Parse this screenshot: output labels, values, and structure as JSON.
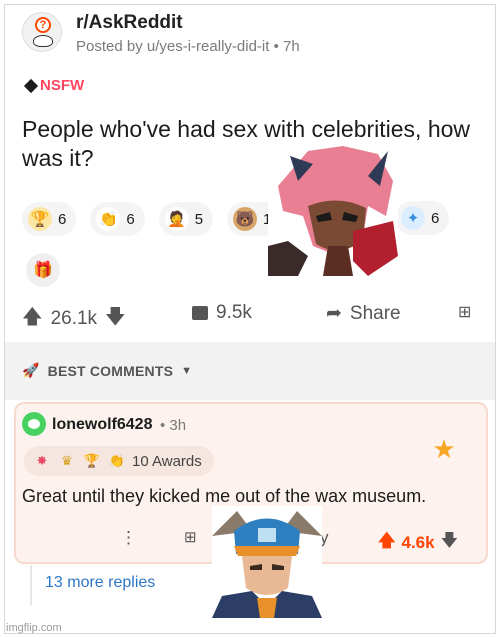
{
  "post": {
    "subreddit": "r/AskReddit",
    "posted_by": "Posted by u/yes-i-really-did-it • 7h",
    "nsfw_tag": "NSFW",
    "title": "People who've had sex with celebrities, how was it?",
    "awards": [
      {
        "icon": "gold-trophy-icon",
        "count": "6",
        "color": "#e8b923"
      },
      {
        "icon": "clapping-hands-icon",
        "count": "6",
        "color": "#8a8a8a"
      },
      {
        "icon": "facepalm-icon",
        "count": "5",
        "color": "#8a8a8a"
      },
      {
        "icon": "bear-icon",
        "count": "1",
        "color": "#8a5a2b"
      },
      {
        "icon": "blue-burst-icon",
        "count": "6",
        "color": "#3b8fe0"
      }
    ],
    "gift_icon": "gift-icon",
    "upvotes": "26.1k",
    "comments": "9.5k",
    "share_label": "Share"
  },
  "section": {
    "best_comments_label": "BEST COMMENTS"
  },
  "comment": {
    "username": "lonewolf6428",
    "time": "• 3h",
    "awards_label": "10 Awards",
    "award_icons": [
      "starburst-icon",
      "gold-crown-icon",
      "trophy-icon",
      "clapping-icon"
    ],
    "text": "Great until they kicked me out of the wax museum.",
    "score": "4.6k",
    "reply_partial": "y"
  },
  "thread": {
    "more_replies": "13 more replies"
  },
  "watermark": "imgflip.com",
  "colors": {
    "accent": "#ff4500",
    "nsfw": "#ff4560",
    "link": "#2d76c6"
  }
}
